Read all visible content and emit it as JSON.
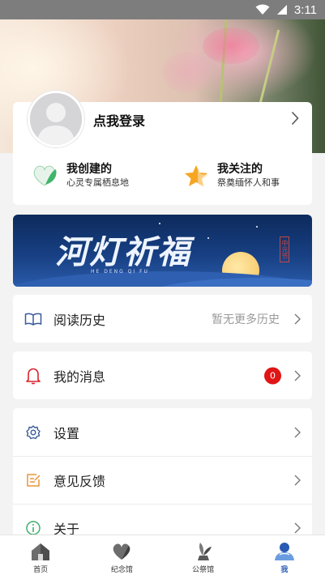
{
  "status_bar": {
    "time": "3:11"
  },
  "profile": {
    "login_label": "点我登录",
    "created": {
      "title": "我创建的",
      "subtitle": "心灵专属栖息地"
    },
    "followed": {
      "title": "我关注的",
      "subtitle": "祭奠缅怀人和事"
    }
  },
  "banner": {
    "title": "河灯祈福",
    "subtitle": "HE DENG QI FU",
    "seal": "中元节"
  },
  "menu": {
    "history": {
      "label": "阅读历史",
      "value": "暂无更多历史"
    },
    "messages": {
      "label": "我的消息",
      "badge": "0"
    },
    "settings": {
      "label": "设置"
    },
    "feedback": {
      "label": "意见反馈"
    },
    "about": {
      "label": "关于"
    }
  },
  "nav": {
    "items": [
      {
        "label": "首页"
      },
      {
        "label": "纪念馆"
      },
      {
        "label": "公祭馆"
      },
      {
        "label": "我"
      }
    ]
  },
  "colors": {
    "accent": "#2a5bb4",
    "badge": "#e01515",
    "banner_bg": "#173f82"
  }
}
